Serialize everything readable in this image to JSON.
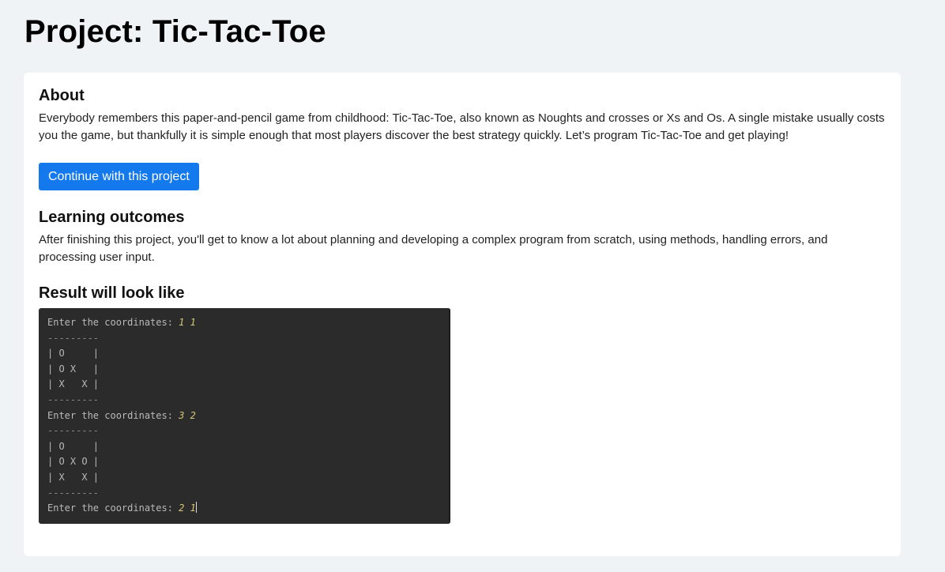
{
  "page": {
    "title": "Project: Tic-Tac-Toe"
  },
  "about": {
    "heading": "About",
    "text": "Everybody remembers this paper-and-pencil game from childhood: Tic-Tac-Toe, also known as Noughts and crosses or Xs and Os. A single mistake usually costs you the game, but thankfully it is simple enough that most players discover the best strategy quickly. Let’s program Tic-Tac-Toe and get playing!"
  },
  "actions": {
    "continue_label": "Continue with this project"
  },
  "learning": {
    "heading": "Learning outcomes",
    "text": "After finishing this project, you'll get to know a lot about planning and developing a complex program from scratch, using methods, handling errors, and processing user input."
  },
  "result": {
    "heading": "Result will look like",
    "terminal": {
      "lines": [
        {
          "prompt": "Enter the coordinates: ",
          "input": "1 1"
        },
        {
          "text": "---------"
        },
        {
          "text": "| O     |"
        },
        {
          "text": "| O X   |"
        },
        {
          "text": "| X   X |"
        },
        {
          "text": "---------"
        },
        {
          "prompt": "Enter the coordinates: ",
          "input": "3 2"
        },
        {
          "text": "---------"
        },
        {
          "text": "| O     |"
        },
        {
          "text": "| O X O |"
        },
        {
          "text": "| X   X |"
        },
        {
          "text": "---------"
        },
        {
          "prompt": "Enter the coordinates: ",
          "input": "2 1"
        }
      ]
    }
  },
  "colors": {
    "background": "#f0f3f6",
    "card": "#ffffff",
    "accent": "#1479ed",
    "terminal_bg": "#2b2b2b",
    "terminal_text": "#b9b9b9",
    "terminal_input": "#d7c77a"
  }
}
